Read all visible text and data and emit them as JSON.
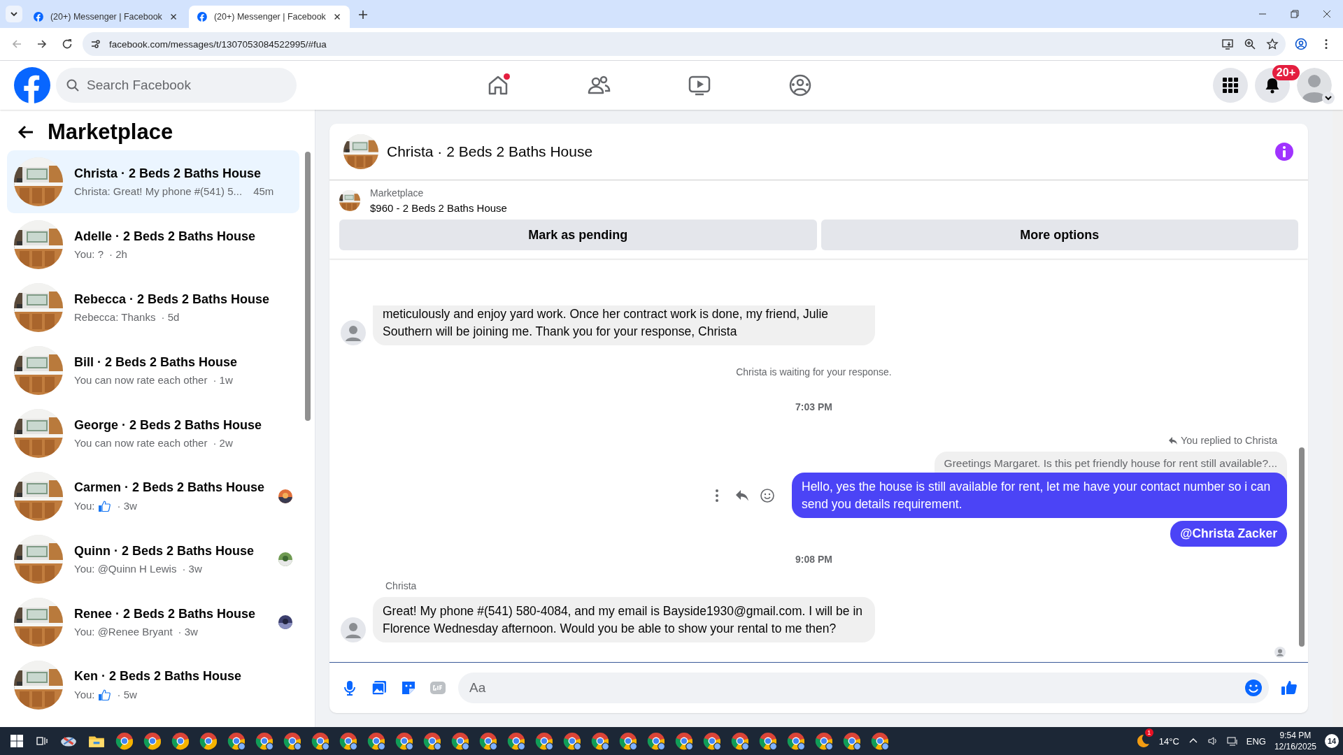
{
  "browser": {
    "tabs": [
      {
        "title": "(20+) Messenger | Facebook",
        "selected": false
      },
      {
        "title": "(20+) Messenger | Facebook",
        "selected": true
      }
    ],
    "url": "facebook.com/messages/t/1307053084522995/#fua"
  },
  "header": {
    "search": {
      "placeholder": "Search Facebook"
    },
    "home_unread": true,
    "notification_badge": "20+"
  },
  "sidebar": {
    "title": "Marketplace",
    "conversations": [
      {
        "name": "Christa · 2 Beds 2 Baths House",
        "preview": "Christa: Great! My phone #(541) 5...",
        "like": false,
        "time": "45m",
        "seen": false,
        "selected": true
      },
      {
        "name": "Adelle · 2 Beds 2 Baths House",
        "preview": "You: ?",
        "like": false,
        "time": "· 2h",
        "seen": false,
        "selected": false
      },
      {
        "name": "Rebecca · 2 Beds 2 Baths House",
        "preview": "Rebecca: Thanks",
        "like": false,
        "time": "· 5d",
        "seen": false,
        "selected": false
      },
      {
        "name": "Bill · 2 Beds 2 Baths House",
        "preview": "You can now rate each other",
        "like": false,
        "time": "· 1w",
        "seen": false,
        "selected": false
      },
      {
        "name": "George · 2 Beds 2 Baths House",
        "preview": "You can now rate each other",
        "like": false,
        "time": "· 2w",
        "seen": false,
        "selected": false
      },
      {
        "name": "Carmen · 2 Beds 2 Baths House",
        "preview": "You:",
        "like": true,
        "time": "· 3w",
        "seen": true,
        "selected": false
      },
      {
        "name": "Quinn · 2 Beds 2 Baths House",
        "preview": "You: @Quinn H Lewis",
        "like": false,
        "time": "· 3w",
        "seen": true,
        "selected": false
      },
      {
        "name": "Renee · 2 Beds 2 Baths House",
        "preview": "You: @Renee Bryant",
        "like": false,
        "time": "· 3w",
        "seen": true,
        "selected": false
      },
      {
        "name": "Ken · 2 Beds 2 Baths House",
        "preview": "You:",
        "like": true,
        "time": "· 5w",
        "seen": false,
        "selected": false
      }
    ]
  },
  "chat": {
    "title": "Christa · 2 Beds 2 Baths House",
    "listing": {
      "source": "Marketplace",
      "item": "$960 - 2 Beds 2 Baths House"
    },
    "actions": [
      "Mark as pending",
      "More options"
    ],
    "messages": [
      {
        "kind": "incoming",
        "text": "meticulously and enjoy yard work. Once her contract work is done, my friend, Julie Southern will be joining me. Thank you for your response, Christa"
      },
      {
        "kind": "notice",
        "text": "Christa is waiting for your response."
      },
      {
        "kind": "time",
        "text": "7:03 PM"
      },
      {
        "kind": "reply_note",
        "text": "You replied to Christa"
      },
      {
        "kind": "quote",
        "text": "Greetings Margaret. Is this pet friendly house for rent still available?..."
      },
      {
        "kind": "outgoing",
        "text": "Hello, yes the house is still available for rent, let me have your contact number so i can send you details requirement."
      },
      {
        "kind": "mention",
        "text": "@Christa Zacker"
      },
      {
        "kind": "time",
        "text": "9:08 PM"
      },
      {
        "kind": "sender",
        "text": "Christa"
      },
      {
        "kind": "incoming",
        "text": "Great! My phone #(541) 580-4084, and my email is Bayside1930@gmail.com. I will be in Florence Wednesday afternoon. Would you be able to show your rental to me then?"
      },
      {
        "kind": "seen"
      }
    ],
    "composer": {
      "placeholder": "Aa"
    }
  },
  "taskbar": {
    "weather_alert": "1",
    "temperature": "14°C",
    "language": "ENG",
    "time": "9:54 PM",
    "date": "12/16/2025",
    "notifications": "14"
  }
}
